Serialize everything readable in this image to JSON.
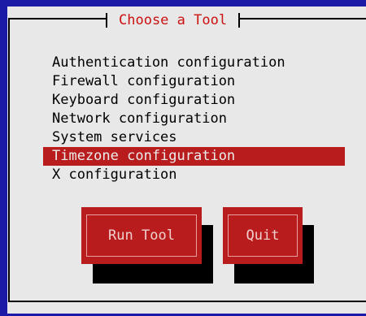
{
  "dialog": {
    "title": "Choose a Tool"
  },
  "menu": {
    "items": [
      {
        "label": "Authentication configuration",
        "selected": false
      },
      {
        "label": "Firewall configuration",
        "selected": false
      },
      {
        "label": "Keyboard configuration",
        "selected": false
      },
      {
        "label": "Network configuration",
        "selected": false
      },
      {
        "label": "System services",
        "selected": false
      },
      {
        "label": "Timezone configuration",
        "selected": true
      },
      {
        "label": "X configuration",
        "selected": false
      }
    ]
  },
  "buttons": {
    "run_tool": "Run Tool",
    "quit": "Quit"
  },
  "colors": {
    "background": "#1a1aa6",
    "dialog": "#e8e8e8",
    "accent": "#b81c1c",
    "title_text": "#cc1111"
  }
}
